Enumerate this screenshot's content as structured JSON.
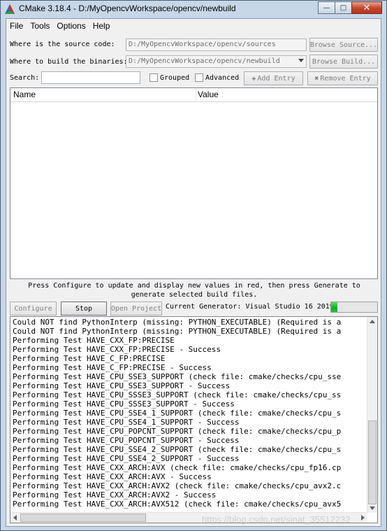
{
  "window": {
    "title": "CMake 3.18.4 - D:/MyOpencvWorkspace/opencv/newbuild",
    "minimize_glyph": "—",
    "maximize_glyph": "□",
    "close_glyph": "✕",
    "app_icon": "cmake-triangle-icon"
  },
  "menu": {
    "file": "File",
    "tools": "Tools",
    "options": "Options",
    "help": "Help"
  },
  "source": {
    "label": "Where is the source code:",
    "path": "D:/MyOpencvWorkspace/opencv/sources",
    "browse_label": "Browse Source..."
  },
  "build": {
    "label": "Where to build the binaries:",
    "path": "D:/MyOpencvWorkspace/opencv/newbuild",
    "browse_label": "Browse Build..."
  },
  "search": {
    "label": "Search:",
    "value": "",
    "grouped_label": "Grouped",
    "advanced_label": "Advanced",
    "add_entry_label": "Add Entry",
    "remove_entry_label": "Remove Entry"
  },
  "table": {
    "columns": [
      "Name",
      "Value"
    ],
    "rows": []
  },
  "hint": "Press Configure to update and display new values in red, then press Generate to generate selected build files.",
  "actions": {
    "configure_label": "Configure",
    "stop_label": "Stop",
    "open_project_label": "Open Project",
    "generator_label": "Current Generator: Visual Studio 16 2019",
    "progress_fraction": 0.14
  },
  "log": {
    "lines": [
      "Could NOT find PythonInterp (missing: PYTHON_EXECUTABLE) (Required is a",
      "Could NOT find PythonInterp (missing: PYTHON_EXECUTABLE) (Required is a",
      "Performing Test HAVE_CXX_FP:PRECISE",
      "Performing Test HAVE_CXX_FP:PRECISE - Success",
      "Performing Test HAVE_C_FP:PRECISE",
      "Performing Test HAVE_C_FP:PRECISE - Success",
      "Performing Test HAVE_CPU_SSE3_SUPPORT (check file: cmake/checks/cpu_sse",
      "Performing Test HAVE_CPU_SSE3_SUPPORT - Success",
      "Performing Test HAVE_CPU_SSSE3_SUPPORT (check file: cmake/checks/cpu_ss",
      "Performing Test HAVE_CPU_SSSE3_SUPPORT - Success",
      "Performing Test HAVE_CPU_SSE4_1_SUPPORT (check file: cmake/checks/cpu_s",
      "Performing Test HAVE_CPU_SSE4_1_SUPPORT - Success",
      "Performing Test HAVE_CPU_POPCNT_SUPPORT (check file: cmake/checks/cpu_p",
      "Performing Test HAVE_CPU_POPCNT_SUPPORT - Success",
      "Performing Test HAVE_CPU_SSE4_2_SUPPORT (check file: cmake/checks/cpu_s",
      "Performing Test HAVE_CPU_SSE4_2_SUPPORT - Success",
      "Performing Test HAVE_CXX_ARCH:AVX (check file: cmake/checks/cpu_fp16.cp",
      "Performing Test HAVE_CXX_ARCH:AVX - Success",
      "Performing Test HAVE_CXX_ARCH:AVX2 (check file: cmake/checks/cpu_avx2.c",
      "Performing Test HAVE_CXX_ARCH:AVX2 - Success",
      "Performing Test HAVE_CXX_ARCH:AVX512 (check file: cmake/checks/cpu_avx5"
    ]
  },
  "watermark": "https://blog.csdn.net/sinat_35512232"
}
